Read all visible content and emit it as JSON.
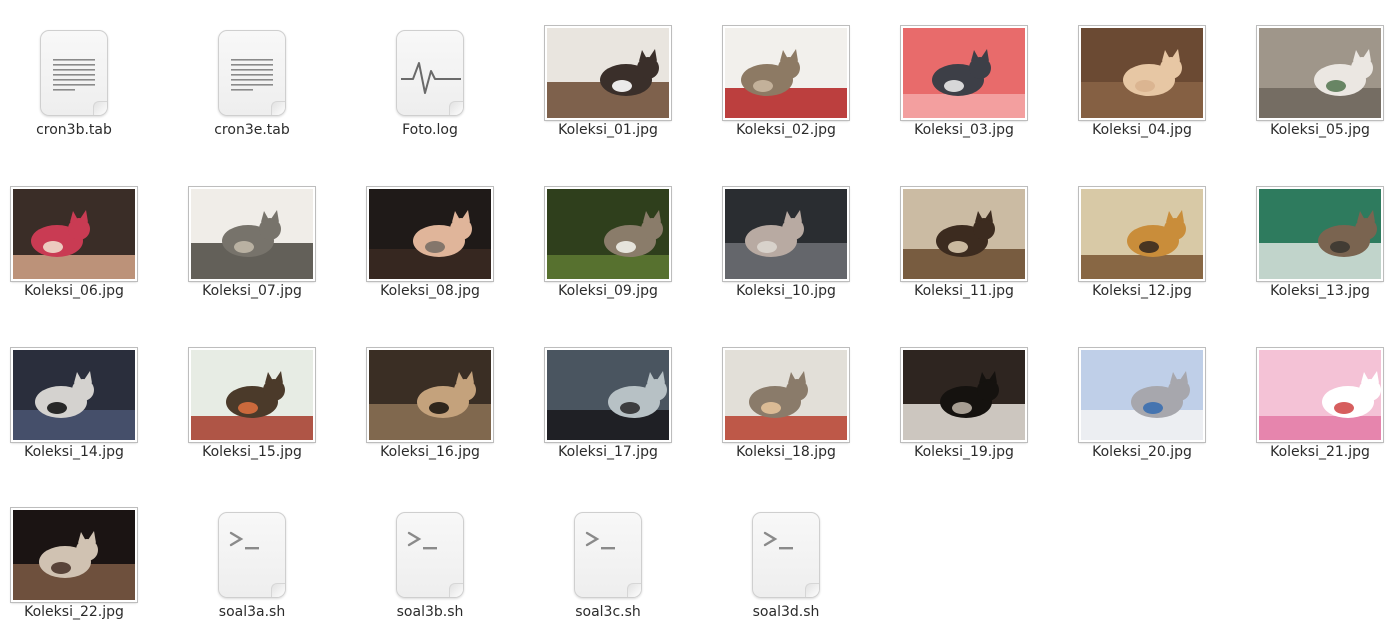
{
  "files": [
    {
      "name": "cron3b.tab",
      "kind": "text",
      "icon": "text-document-icon"
    },
    {
      "name": "cron3e.tab",
      "kind": "text",
      "icon": "text-document-icon"
    },
    {
      "name": "Foto.log",
      "kind": "log",
      "icon": "log-document-icon"
    },
    {
      "name": "Koleksi_01.jpg",
      "kind": "image",
      "icon": "image-thumbnail",
      "colors": [
        "#e9e5df",
        "#6b4a33",
        "#3a2f2a",
        "#ffffff"
      ]
    },
    {
      "name": "Koleksi_02.jpg",
      "kind": "image",
      "icon": "image-thumbnail",
      "colors": [
        "#f2f0ec",
        "#b32020",
        "#8d7a64",
        "#c9b7a0"
      ]
    },
    {
      "name": "Koleksi_03.jpg",
      "kind": "image",
      "icon": "image-thumbnail",
      "colors": [
        "#e86b6b",
        "#f4a8a8",
        "#3d3f47",
        "#e8e8e8"
      ]
    },
    {
      "name": "Koleksi_04.jpg",
      "kind": "image",
      "icon": "image-thumbnail",
      "colors": [
        "#6b4a33",
        "#8a6446",
        "#e7c7a4",
        "#d9b38f"
      ]
    },
    {
      "name": "Koleksi_05.jpg",
      "kind": "image",
      "icon": "image-thumbnail",
      "colors": [
        "#9f968a",
        "#6d665c",
        "#ebe7e2",
        "#5a7a56"
      ]
    },
    {
      "name": "Koleksi_06.jpg",
      "kind": "image",
      "icon": "image-thumbnail",
      "colors": [
        "#3a2d27",
        "#d4a488",
        "#c93b53",
        "#f0dccb"
      ]
    },
    {
      "name": "Koleksi_07.jpg",
      "kind": "image",
      "icon": "image-thumbnail",
      "colors": [
        "#f0ede8",
        "#4a4640",
        "#77736b",
        "#c0b8a8"
      ]
    },
    {
      "name": "Koleksi_08.jpg",
      "kind": "image",
      "icon": "image-thumbnail",
      "colors": [
        "#1f1a18",
        "#3b2a22",
        "#e0b59a",
        "#7a6f66"
      ]
    },
    {
      "name": "Koleksi_09.jpg",
      "kind": "image",
      "icon": "image-thumbnail",
      "colors": [
        "#2f3f1c",
        "#5e7a32",
        "#8a7c6a",
        "#f0efe9"
      ]
    },
    {
      "name": "Koleksi_10.jpg",
      "kind": "image",
      "icon": "image-thumbnail",
      "colors": [
        "#2a2d31",
        "#6f7176",
        "#b8aaa2",
        "#dcd6cf"
      ]
    },
    {
      "name": "Koleksi_11.jpg",
      "kind": "image",
      "icon": "image-thumbnail",
      "colors": [
        "#cbbba3",
        "#6a4b2f",
        "#3c2b1f",
        "#d9c9ad"
      ]
    },
    {
      "name": "Koleksi_12.jpg",
      "kind": "image",
      "icon": "image-thumbnail",
      "colors": [
        "#d8c9a6",
        "#7a5632",
        "#c98d3a",
        "#3a2b20"
      ]
    },
    {
      "name": "Koleksi_13.jpg",
      "kind": "image",
      "icon": "image-thumbnail",
      "colors": [
        "#2e7b5e",
        "#dbe4de",
        "#7a6450",
        "#3c3731"
      ]
    },
    {
      "name": "Koleksi_14.jpg",
      "kind": "image",
      "icon": "image-thumbnail",
      "colors": [
        "#2a2e3c",
        "#4a5572",
        "#d4d2cf",
        "#151515"
      ]
    },
    {
      "name": "Koleksi_15.jpg",
      "kind": "image",
      "icon": "image-thumbnail",
      "colors": [
        "#e7ece4",
        "#a43b2a",
        "#4b3a2a",
        "#d96f3e"
      ]
    },
    {
      "name": "Koleksi_16.jpg",
      "kind": "image",
      "icon": "image-thumbnail",
      "colors": [
        "#3a2e24",
        "#8d7256",
        "#c4a27c",
        "#1f1812"
      ]
    },
    {
      "name": "Koleksi_17.jpg",
      "kind": "image",
      "icon": "image-thumbnail",
      "colors": [
        "#4a5560",
        "#17181b",
        "#b7c1c5",
        "#2f2f30"
      ]
    },
    {
      "name": "Koleksi_18.jpg",
      "kind": "image",
      "icon": "image-thumbnail",
      "colors": [
        "#e2dfd8",
        "#b7412f",
        "#8a7b6a",
        "#e3c29a"
      ]
    },
    {
      "name": "Koleksi_19.jpg",
      "kind": "image",
      "icon": "image-thumbnail",
      "colors": [
        "#2e2520",
        "#e8e3dc",
        "#15120f",
        "#b7aea2"
      ]
    },
    {
      "name": "Koleksi_20.jpg",
      "kind": "image",
      "icon": "image-thumbnail",
      "colors": [
        "#bfcfe8",
        "#f3f3f3",
        "#a7a7ad",
        "#3b6fb0"
      ]
    },
    {
      "name": "Koleksi_21.jpg",
      "kind": "image",
      "icon": "image-thumbnail",
      "colors": [
        "#f4c2d6",
        "#e37aa6",
        "#ffffff",
        "#d14d4d"
      ]
    },
    {
      "name": "Koleksi_22.jpg",
      "kind": "image",
      "icon": "image-thumbnail",
      "colors": [
        "#1b1413",
        "#7d5a45",
        "#d0c2b2",
        "#4a352b"
      ]
    },
    {
      "name": "soal3a.sh",
      "kind": "script",
      "icon": "terminal-script-icon"
    },
    {
      "name": "soal3b.sh",
      "kind": "script",
      "icon": "terminal-script-icon"
    },
    {
      "name": "soal3c.sh",
      "kind": "script",
      "icon": "terminal-script-icon"
    },
    {
      "name": "soal3d.sh",
      "kind": "script",
      "icon": "terminal-script-icon"
    }
  ]
}
